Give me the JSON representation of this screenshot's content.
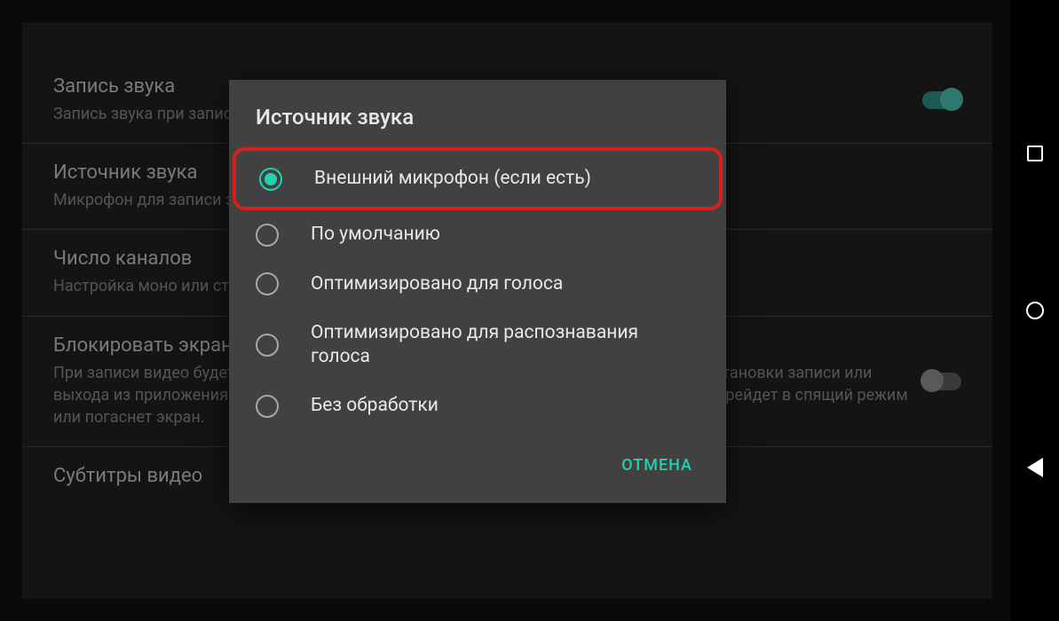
{
  "settings": {
    "item1": {
      "title": "Запись звука",
      "desc": "Запись звука при записи видео"
    },
    "item2": {
      "title": "Источник звука",
      "desc": "Микрофон для записи звука\nВнешний микрофон (если есть)"
    },
    "item3": {
      "title": "Число каналов",
      "desc": "Настройка моно или стерео записи"
    },
    "item4": {
      "title": "Блокировать экран",
      "desc": "При записи видео будет выключен сенсорный экран для предотвращения случайной остановки записи или выхода из приложения. Обратите внимание, что запись будет прервана, если телефон перейдет в спящий режим или погаснет экран."
    },
    "item5": {
      "title": "Субтитры видео"
    }
  },
  "dialog": {
    "title": "Источник звука",
    "options": {
      "opt1": "Внешний микрофон (если есть)",
      "opt2": "По умолчанию",
      "opt3": "Оптимизировано для голоса",
      "opt4": "Оптимизировано для распознавания голоса",
      "opt5": "Без обработки"
    },
    "cancel": "ОТМЕНА"
  }
}
